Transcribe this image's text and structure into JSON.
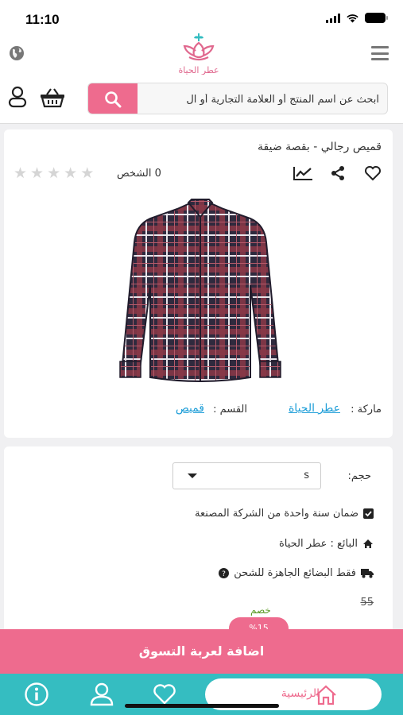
{
  "status_bar": {
    "time": "11:10"
  },
  "header": {
    "logo_text": "عطر الحياة"
  },
  "search": {
    "placeholder": "ابحث عن اسم المنتج أو العلامة التجارية أو ال"
  },
  "product": {
    "title": "قميص رجالي - بقصة ضيقة",
    "rating_count": "0 الشخص",
    "stars": 5,
    "rating": 0,
    "brand_label": "ماركة :",
    "brand_value": "عطر الحياة",
    "category_label": "القسم :",
    "category_value": "قميص"
  },
  "options": {
    "size_label": "حجم:",
    "size_value": "s",
    "warranty": "ضمان سنة واحدة من الشركة المصنعة",
    "seller": "البائع : عطر الحياة",
    "shipping": "فقط البضائع الجاهزة للشحن",
    "old_price": "55",
    "discount_label": "خصم",
    "discount_value": "%15"
  },
  "add_to_cart": "اضافة لعربة التسوق",
  "nav": {
    "home_label": "الرئيسية"
  },
  "colors": {
    "accent": "#ee6b8e",
    "nav_bg": "#35bdc1",
    "link": "#1e9ed8"
  }
}
